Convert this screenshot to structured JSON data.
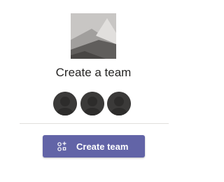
{
  "card": {
    "title": "Create a team",
    "image_icon": "team-placeholder-image",
    "member_avatars": [
      "person-avatar",
      "person-avatar",
      "person-avatar"
    ],
    "button": {
      "label": "Create team",
      "icon": "add-team-icon"
    }
  },
  "colors": {
    "accent": "#6264a7",
    "title_text": "#252423",
    "avatar_bg": "#3b3a39",
    "divider": "#e1dfdd"
  }
}
